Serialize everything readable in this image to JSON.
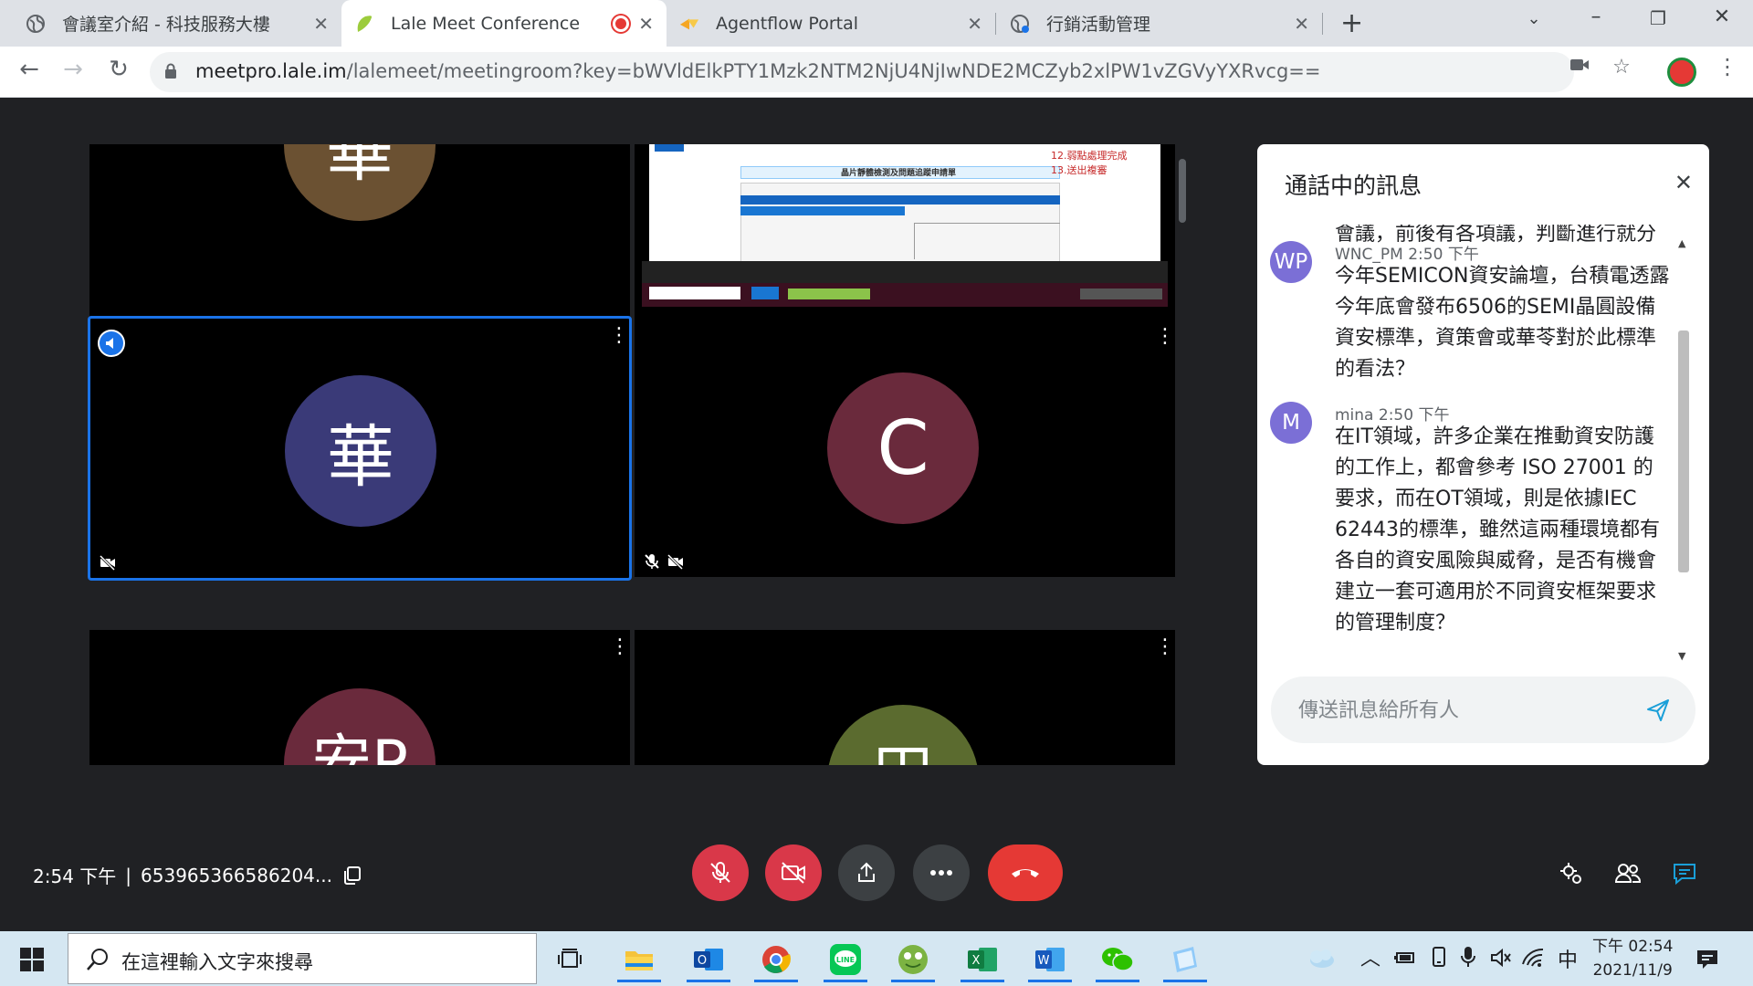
{
  "browser": {
    "tabs": [
      {
        "title": "會議室介紹 - 科技服務大樓",
        "active": false
      },
      {
        "title": "Lale Meet Conference",
        "active": true,
        "recording": true
      },
      {
        "title": "Agentflow Portal",
        "active": false
      },
      {
        "title": "行銷活動管理",
        "active": false
      }
    ],
    "url_host": "meetpro.lale.im",
    "url_path": "/lalemeet/meetingroom?key=bWVldElkPTY1Mzk2NTM2NjU4NjIwNDE2MCZyb2xlPW1vZGVyYXRvcg=="
  },
  "grid": {
    "tiles": [
      {
        "initial": "華",
        "color": "#6b5132",
        "muted": true,
        "video_off": true
      },
      {
        "type": "screen-share",
        "slide_title": "晶片靜體檢測及問題追蹤申請單",
        "slide_note_1": "12.弱點處理完成",
        "slide_note_2": "13.送出複審"
      },
      {
        "initial": "華",
        "color": "#3a3a78",
        "speaking": true,
        "video_off": true
      },
      {
        "initial": "C",
        "color": "#6a2a3c",
        "muted": true,
        "video_off": true
      },
      {
        "initial": "安P",
        "color": "#6a2a3c"
      },
      {
        "initial": "田",
        "color": "#5b6b2f"
      }
    ]
  },
  "chat": {
    "title": "通話中的訊息",
    "cut_line": "會議，前後有各項議，判斷進行就分",
    "messages": [
      {
        "avatar": "WP",
        "name": "WNC_PM",
        "time": "2:50 下午",
        "text": "今年SEMICON資安論壇，台積電透露今年底會發布6506的SEMI晶圓設備資安標準，資策會或華苓對於此標準的看法？"
      },
      {
        "avatar": "M",
        "name": "mina",
        "time": "2:50 下午",
        "text": "在IT領域，許多企業在推動資安防護的工作上，都會參考 ISO 27001 的要求，而在OT領域，則是依據IEC 62443的標準，雖然這兩種環境都有各自的資安風險與威脅，是否有機會建立一套可適用於不同資安框架要求的管理制度？"
      }
    ],
    "input_placeholder": "傳送訊息給所有人"
  },
  "meeting": {
    "time": "2:54 下午",
    "separator": "|",
    "id": "653965366586204..."
  },
  "taskbar": {
    "search_placeholder": "在這裡輸入文字來搜尋",
    "ime": "中",
    "clock_time": "下午 02:54",
    "clock_date": "2021/11/9"
  },
  "colors": {
    "accent": "#1a73e8",
    "danger": "#d93849",
    "end_call": "#e53935"
  }
}
